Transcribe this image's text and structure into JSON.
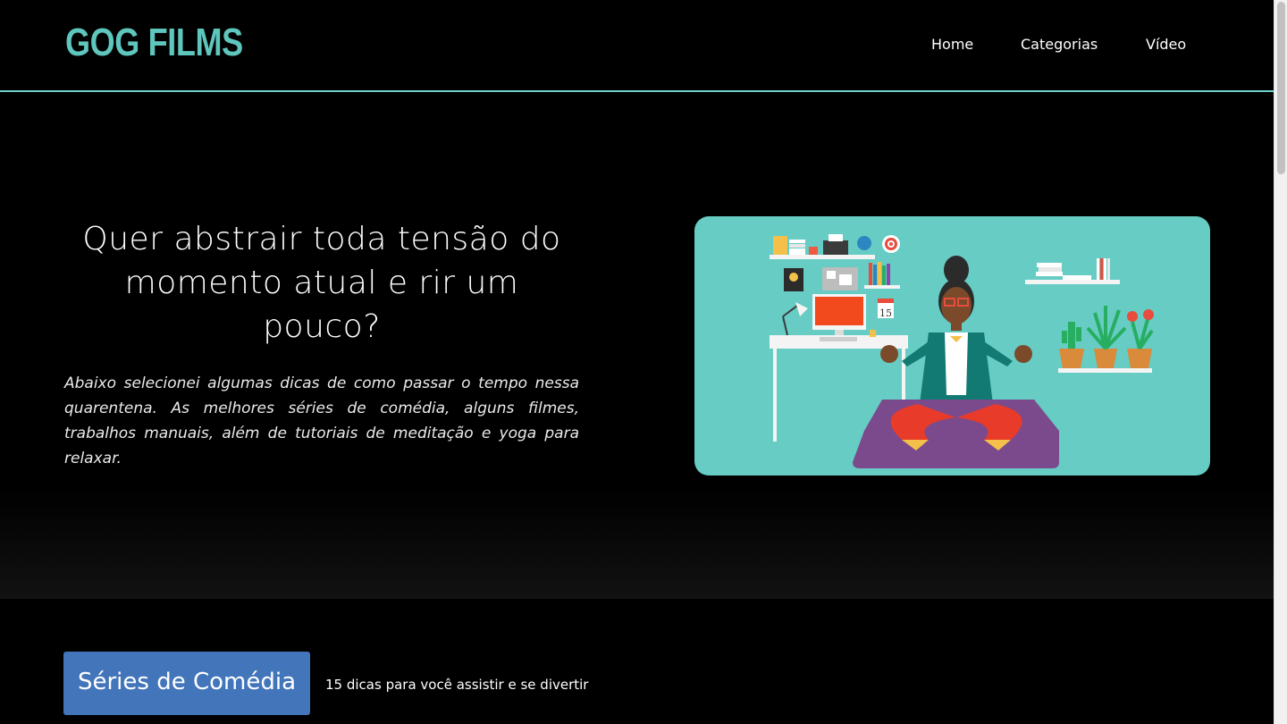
{
  "header": {
    "logo": "GOG FILMS",
    "nav": [
      "Home",
      "Categorias",
      "Vídeo"
    ]
  },
  "hero": {
    "title": "Quer abstrair toda tensão do momento atual e rir um pouco?",
    "text": "Abaixo selecionei algumas dicas de como passar o tempo nessa quarentena. As melhores séries de comédia, alguns filmes, trabalhos manuais, além de tutoriais de meditação e yoga para relaxar.",
    "illustration": "meditating-woman-illustration"
  },
  "section": {
    "button_label": "Séries de Comédia",
    "subtitle": "15 dicas para você assistir e se divertir"
  },
  "colors": {
    "accent": "#5ec6bd",
    "header_border": "#6fd1c6",
    "button": "#4375bb",
    "illustration_bg": "#66ccc4",
    "background": "#000000"
  },
  "calendar_day": "15"
}
